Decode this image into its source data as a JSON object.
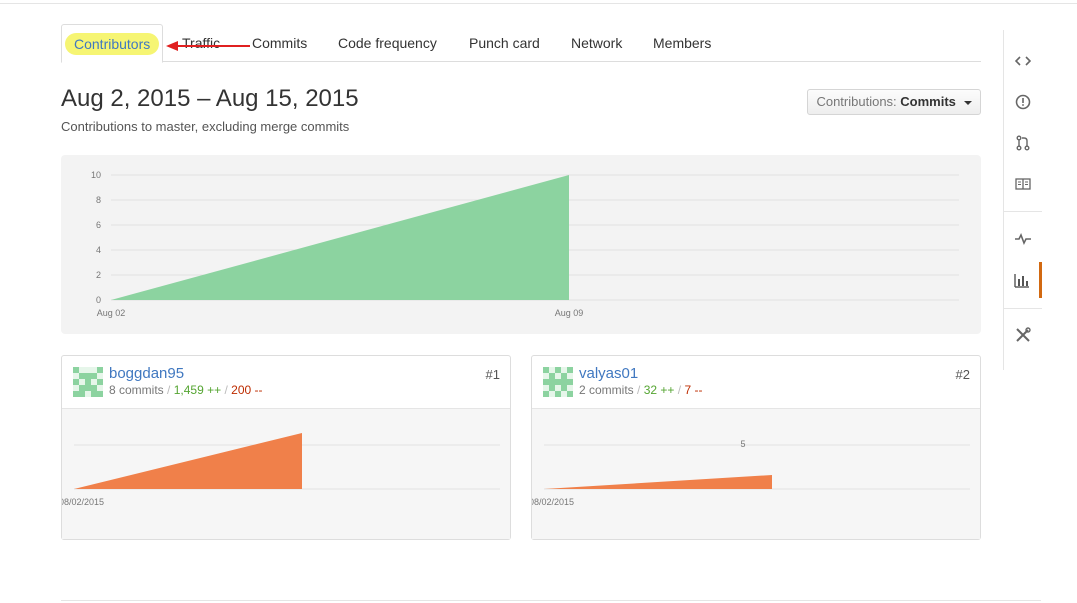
{
  "tabs": [
    {
      "label": "Contributors",
      "selected": true
    },
    {
      "label": "Traffic"
    },
    {
      "label": "Commits"
    },
    {
      "label": "Code frequency"
    },
    {
      "label": "Punch card"
    },
    {
      "label": "Network"
    },
    {
      "label": "Members"
    }
  ],
  "header": {
    "date_range": "Aug 2, 2015 – Aug 15, 2015",
    "subtitle": "Contributions to master, excluding merge commits"
  },
  "contributions_select": {
    "prefix": "Contributions:",
    "value": "Commits"
  },
  "chart_data": [
    {
      "type": "area",
      "x": [
        "Aug 02",
        "Aug 09"
      ],
      "y": [
        0,
        10
      ],
      "ylim": [
        0,
        10
      ],
      "yticks": [
        "0",
        "2",
        "4",
        "6",
        "8",
        "10"
      ],
      "xticks": [
        "Aug 02",
        "Aug 09"
      ],
      "color": "#8cd3a0",
      "grid": true
    },
    {
      "type": "area",
      "x": [
        "08/02/2015",
        ""
      ],
      "y": [
        0,
        8
      ],
      "color": "#f0804a"
    },
    {
      "type": "area",
      "x": [
        "08/02/2015",
        ""
      ],
      "y": [
        0,
        2
      ],
      "ytick": "5",
      "color": "#f0804a"
    }
  ],
  "contributors": [
    {
      "name": "boggdan95",
      "commits": "8 commits",
      "additions": "1,459 ++",
      "deletions": "200 --",
      "rank": "#1",
      "date_label": "08/02/2015"
    },
    {
      "name": "valyas01",
      "commits": "2 commits",
      "additions": "32 ++",
      "deletions": "7 --",
      "rank": "#2",
      "date_label": "08/02/2015",
      "ytick": "5"
    }
  ],
  "separator": "/",
  "sidebar_icons": [
    "code-icon",
    "issue-icon",
    "pull-request-icon",
    "wiki-icon",
    "pulse-icon",
    "graph-icon",
    "settings-icon"
  ],
  "colors": {
    "accent": "#d26911",
    "link": "#4078c0",
    "area_main": "#8cd3a0",
    "area_user": "#f0804a",
    "highlight": "#f5f35a",
    "arrow": "#e02020"
  }
}
